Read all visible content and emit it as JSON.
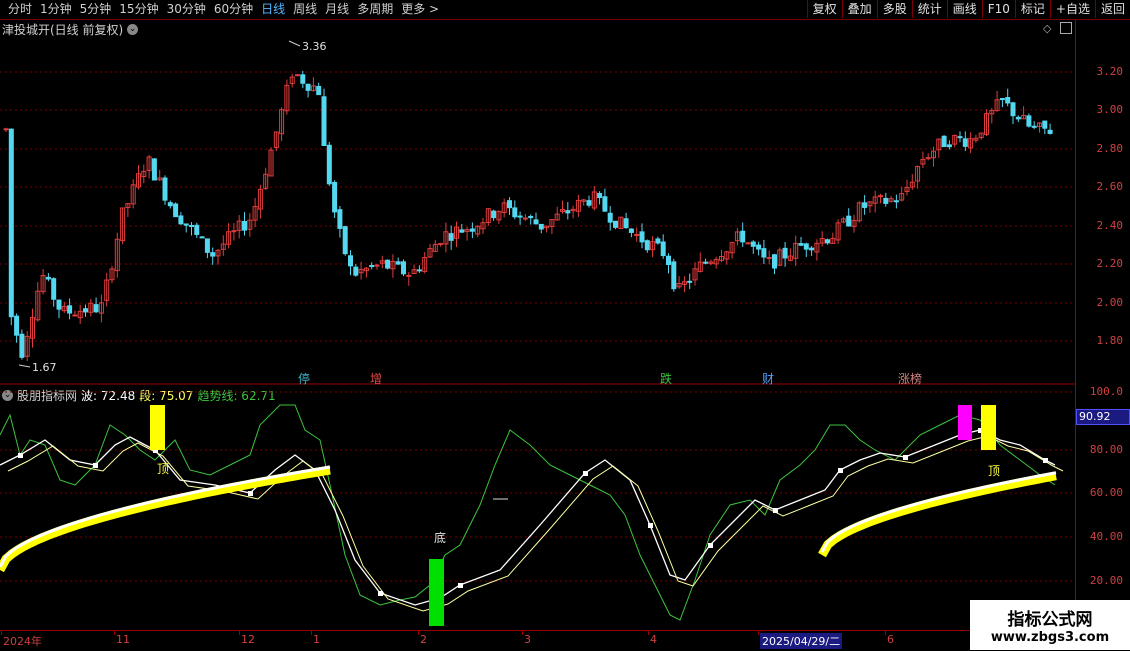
{
  "periods": [
    "分时",
    "1分钟",
    "5分钟",
    "15分钟",
    "30分钟",
    "60分钟",
    "日线",
    "周线",
    "月线",
    "多周期",
    "更多 >"
  ],
  "active_period": "日线",
  "tools": [
    "复权",
    "叠加",
    "多股",
    "统计",
    "画线",
    "F10",
    "标记",
    "+自选",
    "返回"
  ],
  "stock_title": "津投城开(日线 前复权)",
  "price_axis": [
    "3.20",
    "3.00",
    "2.80",
    "2.60",
    "2.40",
    "2.20",
    "2.00",
    "1.80"
  ],
  "price_high_label": "3.36",
  "price_low_label": "1.67",
  "events": [
    {
      "text": "停",
      "color": "#3fb6c8"
    },
    {
      "text": "增",
      "color": "#e04848"
    },
    {
      "text": "跌",
      "color": "#3ec43e"
    },
    {
      "text": "财",
      "color": "#52a0ff"
    },
    {
      "text": "涨榜",
      "color": "#d08080"
    }
  ],
  "indicator": {
    "name": "股朋指标网",
    "wave_label": "波: 72.48",
    "seg_label": "段: 75.07",
    "trend_label": "趋势线: 62.71",
    "axis": [
      "100.0",
      "80.00",
      "60.00",
      "40.00",
      "20.00"
    ],
    "current_value": "90.92",
    "marker_top": "顶",
    "marker_bottom": "底"
  },
  "dates": [
    "2024年",
    "11",
    "12",
    "1",
    "2",
    "3",
    "4",
    "2025/04/29/二",
    "6"
  ],
  "watermark": {
    "line1": "指标公式网",
    "line2": "www.zbgs3.com"
  },
  "colors": {
    "up": "#e03c3c",
    "down": "#54d8f0",
    "trend": "#ffff00",
    "wave": "#ffffff",
    "seg": "#ffffa0",
    "green": "#3ec43e"
  }
}
